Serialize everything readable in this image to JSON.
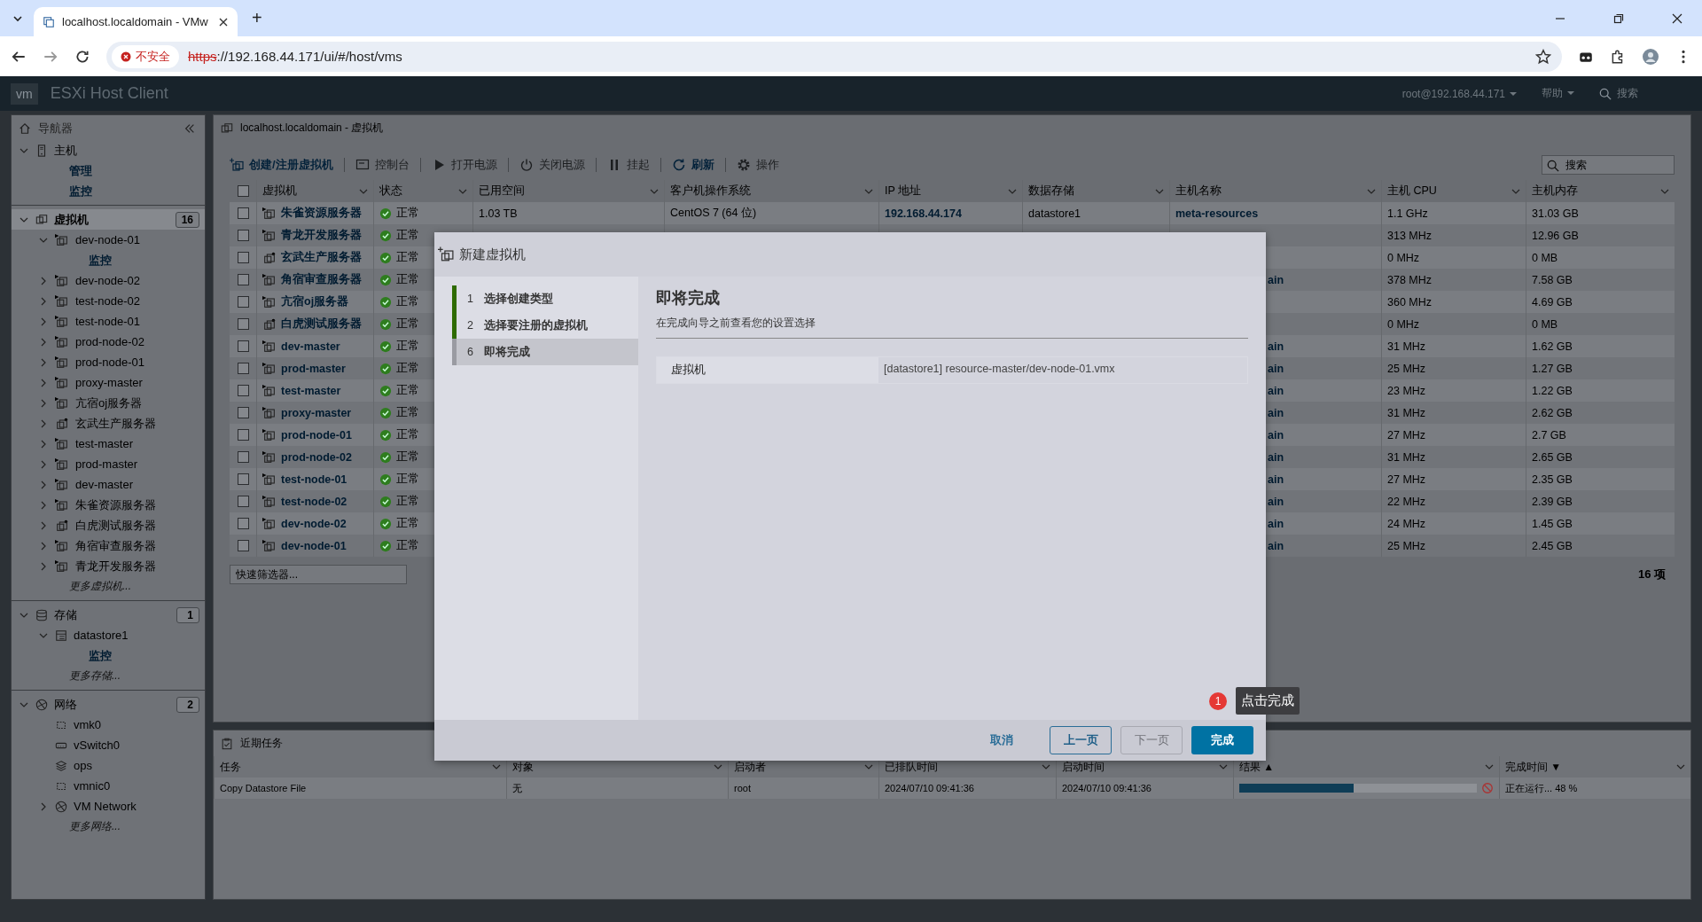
{
  "browser": {
    "tab_title": "localhost.localdomain - VMw",
    "new_tab": "+",
    "security": "不安全",
    "url_scheme": "https",
    "url_rest": "://192.168.44.171/ui/#/host/vms"
  },
  "app_header": {
    "logo": "vm",
    "title": "ESXi Host Client",
    "user": "root@192.168.44.171",
    "help": "帮助",
    "search": "搜索"
  },
  "navigator": {
    "title": "导航器",
    "tree": [
      {
        "kind": "section",
        "label": "主机",
        "selected": false,
        "expanded": true,
        "children": [
          {
            "kind": "link",
            "label": "管理"
          },
          {
            "kind": "link",
            "label": "监控"
          }
        ]
      },
      {
        "kind": "section",
        "label": "虚拟机",
        "count": "16",
        "selected": true,
        "expanded": true,
        "children": [
          {
            "kind": "vm",
            "label": "dev-node-01",
            "running": true,
            "expanded": true,
            "children": [
              {
                "kind": "link",
                "label": "监控"
              }
            ]
          },
          {
            "kind": "vm",
            "label": "dev-node-02",
            "running": true,
            "expanded": false
          },
          {
            "kind": "vm",
            "label": "test-node-02",
            "running": true,
            "expanded": false
          },
          {
            "kind": "vm",
            "label": "test-node-01",
            "running": true,
            "expanded": false
          },
          {
            "kind": "vm",
            "label": "prod-node-02",
            "running": true,
            "expanded": false
          },
          {
            "kind": "vm",
            "label": "prod-node-01",
            "running": true,
            "expanded": false
          },
          {
            "kind": "vm",
            "label": "proxy-master",
            "running": true,
            "expanded": false
          },
          {
            "kind": "vm",
            "label": "亢宿oj服务器",
            "running": true,
            "expanded": false
          },
          {
            "kind": "vm",
            "label": "玄武生产服务器",
            "running": false,
            "expanded": false
          },
          {
            "kind": "vm",
            "label": "test-master",
            "running": true,
            "expanded": false
          },
          {
            "kind": "vm",
            "label": "prod-master",
            "running": true,
            "expanded": false
          },
          {
            "kind": "vm",
            "label": "dev-master",
            "running": true,
            "expanded": false
          },
          {
            "kind": "vm",
            "label": "朱雀资源服务器",
            "running": true,
            "expanded": false
          },
          {
            "kind": "vm",
            "label": "白虎测试服务器",
            "running": false,
            "expanded": false
          },
          {
            "kind": "vm",
            "label": "角宿审查服务器",
            "running": true,
            "expanded": false
          },
          {
            "kind": "vm",
            "label": "青龙开发服务器",
            "running": true,
            "expanded": false
          },
          {
            "kind": "more",
            "label": "更多虚拟机..."
          }
        ]
      },
      {
        "kind": "section",
        "label": "存储",
        "count": "1",
        "selected": false,
        "expanded": true,
        "children": [
          {
            "kind": "datastore",
            "label": "datastore1",
            "expanded": true,
            "children": [
              {
                "kind": "link",
                "label": "监控"
              }
            ]
          },
          {
            "kind": "more",
            "label": "更多存储..."
          }
        ]
      },
      {
        "kind": "section",
        "label": "网络",
        "count": "2",
        "selected": false,
        "expanded": true,
        "children": [
          {
            "kind": "nic",
            "label": "vmk0"
          },
          {
            "kind": "switch",
            "label": "vSwitch0"
          },
          {
            "kind": "portgroup",
            "label": "ops"
          },
          {
            "kind": "nic",
            "label": "vmnic0"
          },
          {
            "kind": "network",
            "label": "VM Network",
            "expanded": false
          },
          {
            "kind": "more",
            "label": "更多网络..."
          }
        ]
      }
    ]
  },
  "main": {
    "title": "localhost.localdomain - 虚拟机",
    "toolbar": [
      {
        "label": "创建/注册虚拟机",
        "disabled": false
      },
      {
        "label": "控制台",
        "disabled": true
      },
      {
        "label": "打开电源",
        "disabled": true
      },
      {
        "label": "关闭电源",
        "disabled": true
      },
      {
        "label": "挂起",
        "disabled": true
      },
      {
        "label": "刷新",
        "disabled": false
      },
      {
        "label": "操作",
        "disabled": true
      }
    ],
    "search": {
      "placeholder": "搜索"
    },
    "table": {
      "header_checked": false,
      "columns": [
        "虚拟机",
        "状态",
        "已用空间",
        "客户机操作系统",
        "IP 地址",
        "数据存储",
        "主机名称",
        "主机 CPU",
        "主机内存"
      ],
      "rows": [
        {
          "checked": false,
          "name": "朱雀资源服务器",
          "running": true,
          "status": "正常",
          "used": "1.03 TB",
          "os": "CentOS 7 (64 位)",
          "ip": "192.168.44.174",
          "datastore": "datastore1",
          "host": "meta-resources",
          "cpu": "1.1 GHz",
          "memory": "31.03 GB"
        },
        {
          "checked": false,
          "name": "青龙开发服务器",
          "running": true,
          "status": "正常",
          "cpu": "313 MHz",
          "memory": "12.96 GB"
        },
        {
          "checked": false,
          "name": "玄武生产服务器",
          "running": false,
          "status": "正常",
          "cpu": "0 MHz",
          "memory": "0 MB"
        },
        {
          "checked": false,
          "name": "角宿审查服务器",
          "running": true,
          "status": "正常",
          "host_fragment": "ain",
          "cpu": "378 MHz",
          "memory": "7.58 GB"
        },
        {
          "checked": false,
          "name": "亢宿oj服务器",
          "running": true,
          "status": "正常",
          "cpu": "360 MHz",
          "memory": "4.69 GB"
        },
        {
          "checked": false,
          "name": "白虎测试服务器",
          "running": false,
          "status": "正常",
          "cpu": "0 MHz",
          "memory": "0 MB"
        },
        {
          "checked": false,
          "name": "dev-master",
          "running": true,
          "status": "正常",
          "host_fragment": "ain",
          "cpu": "31 MHz",
          "memory": "1.62 GB"
        },
        {
          "checked": false,
          "name": "prod-master",
          "running": true,
          "status": "正常",
          "host_fragment": "ain",
          "cpu": "25 MHz",
          "memory": "1.27 GB"
        },
        {
          "checked": false,
          "name": "test-master",
          "running": true,
          "status": "正常",
          "host_fragment": "ain",
          "cpu": "23 MHz",
          "memory": "1.22 GB"
        },
        {
          "checked": false,
          "name": "proxy-master",
          "running": true,
          "status": "正常",
          "host_fragment": "ain",
          "cpu": "31 MHz",
          "memory": "2.62 GB"
        },
        {
          "checked": false,
          "name": "prod-node-01",
          "running": true,
          "status": "正常",
          "host_fragment": "ain",
          "cpu": "27 MHz",
          "memory": "2.7 GB"
        },
        {
          "checked": false,
          "name": "prod-node-02",
          "running": true,
          "status": "正常",
          "host_fragment": "ain",
          "cpu": "31 MHz",
          "memory": "2.65 GB"
        },
        {
          "checked": false,
          "name": "test-node-01",
          "running": true,
          "status": "正常",
          "host_fragment": "ain",
          "cpu": "27 MHz",
          "memory": "2.35 GB"
        },
        {
          "checked": false,
          "name": "test-node-02",
          "running": true,
          "status": "正常",
          "host_fragment": "ain",
          "cpu": "22 MHz",
          "memory": "2.39 GB"
        },
        {
          "checked": false,
          "name": "dev-node-02",
          "running": true,
          "status": "正常",
          "host_fragment": "ain",
          "cpu": "24 MHz",
          "memory": "1.45 GB"
        },
        {
          "checked": false,
          "name": "dev-node-01",
          "running": true,
          "status": "正常",
          "host_fragment": "ain",
          "cpu": "25 MHz",
          "memory": "2.45 GB"
        }
      ]
    },
    "quick_filter": {
      "placeholder": "快速筛选器..."
    },
    "item_count": "16 项"
  },
  "tasks": {
    "title": "近期任务",
    "columns": [
      "任务",
      "对象",
      "启动者",
      "已排队时间",
      "启动时间",
      "结果 ▲",
      "完成时间 ▼"
    ],
    "rows": [
      {
        "task": "Copy Datastore File",
        "target": "无",
        "initiator": "root",
        "queued": "2024/07/10 09:41:36",
        "started": "2024/07/10 09:41:36",
        "level": 0.48,
        "completed": "正在运行... 48 %"
      }
    ]
  },
  "dialog": {
    "title": "新建虚拟机",
    "steps": [
      {
        "number": "1",
        "label": "选择创建类型",
        "completed": true,
        "selected": false
      },
      {
        "number": "2",
        "label": "选择要注册的虚拟机",
        "completed": true,
        "selected": false
      },
      {
        "number": "6",
        "label": "即将完成",
        "completed": false,
        "selected": true
      }
    ],
    "heading": "即将完成",
    "subtitle": "在完成向导之前查看您的设置选择",
    "summary": [
      {
        "label": "虚拟机",
        "value": "[datastore1] resource-master/dev-node-01.vmx"
      }
    ],
    "buttons": [
      {
        "kind": "link",
        "label": "取消",
        "disabled": false
      },
      {
        "kind": "outline",
        "label": "上一页",
        "disabled": false
      },
      {
        "kind": "outline",
        "label": "下一页",
        "disabled": true
      },
      {
        "kind": "primary",
        "label": "完成",
        "disabled": false
      }
    ],
    "hint": {
      "badge": "1",
      "text": "点击完成"
    }
  }
}
